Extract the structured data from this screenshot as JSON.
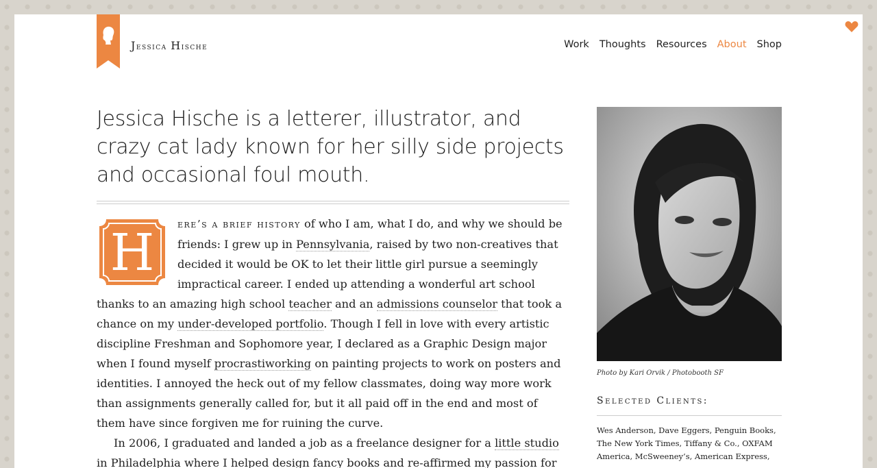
{
  "header": {
    "logo_name_first_cap": "J",
    "logo_name_first_rest": "essica",
    "logo_name_last_cap": "H",
    "logo_name_last_rest": "ische",
    "nav": [
      "Work",
      "Thoughts",
      "Resources",
      "About",
      "Shop"
    ],
    "active_nav": "About"
  },
  "intro": "Jessica Hische is a letterer, illustrator, and crazy cat lady known for her silly side projects and occasional foul mouth.",
  "body": {
    "dropcap_letter": "H",
    "lead_smallcaps": "ere’s a brief history",
    "p1_a": " of who I am, what I do, and why we should be friends: I grew up in ",
    "p1_link1": "Pennsylvania",
    "p1_b": ", raised by two non-creatives that decided it would be OK to let their little girl pursue a seemingly impractical career. I ended up attending a wonderful art school thanks to an amazing high school ",
    "p1_link2": "teacher",
    "p1_c": " and an ",
    "p1_link3": "admissions counselor",
    "p1_d": " that took a chance on my ",
    "p1_link4": "under-developed portfolio",
    "p1_e": ". Though I fell in love with every artistic discipline Freshman and Sophomore year, I declared as a Graphic Design major when I found myself ",
    "p1_link5": "procrastiworking",
    "p1_f": " on painting projects to work on posters and identities. I annoyed the heck out of my fellow classmates, doing way more work than assignments generally called for, but it all paid off in the end and most of them have since forgiven me for ruining the curve.",
    "p2_a": "In 2006, I graduated and landed a job as a freelance designer for a ",
    "p2_link1": "little studio",
    "p2_b": " in Philadelphia where I helped design fancy books and re-affirmed my passion for"
  },
  "sidebar": {
    "caption": "Photo by Kari Orvik / Photobooth SF",
    "clients_heading": "Selected Clients:",
    "clients": "Wes Anderson, Dave Eggers, Penguin Books, The New York Times, Tiffany & Co., OXFAM America, McSweeney’s, American Express,"
  },
  "colors": {
    "accent": "#ec8742",
    "text": "#222222"
  }
}
